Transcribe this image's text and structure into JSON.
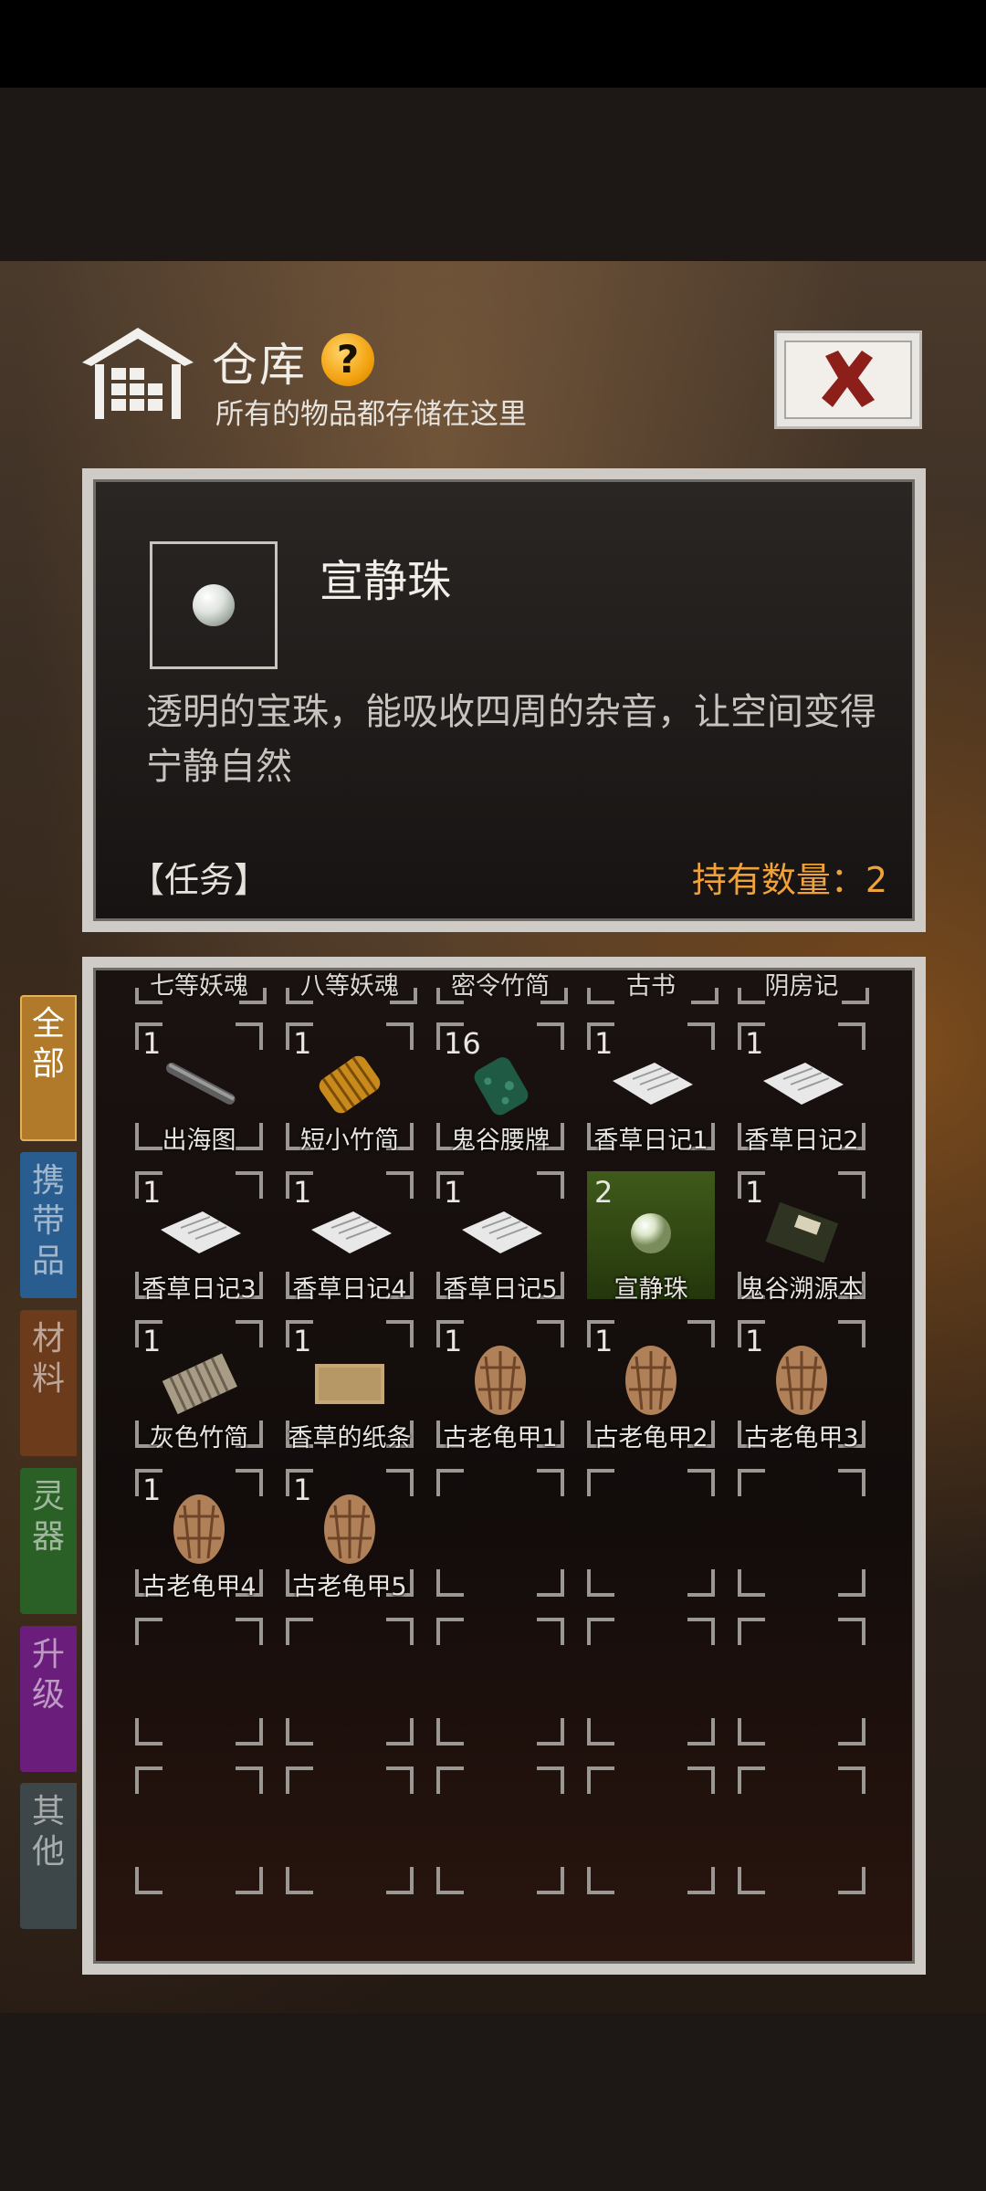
{
  "header": {
    "title": "仓库",
    "help": "?",
    "subtitle": "所有的物品都存储在这里",
    "close_icon": "close-x-icon"
  },
  "detail": {
    "name": "宣静珠",
    "description": "透明的宝珠，能吸收四周的杂音，让空间变得宁静自然",
    "tag": "【任务】",
    "count_text": "持有数量：2"
  },
  "tabs": [
    {
      "label": "全部",
      "color": "#b07a2a",
      "active": true
    },
    {
      "label": "携带品",
      "color": "#2a5d8f",
      "active": false
    },
    {
      "label": "材料",
      "color": "#6b3b1c",
      "active": false
    },
    {
      "label": "灵器",
      "color": "#2a5f25",
      "active": false
    },
    {
      "label": "升级",
      "color": "#6a1d7a",
      "active": false
    },
    {
      "label": "其他",
      "color": "#3d4648",
      "active": false
    }
  ],
  "grid": {
    "partial_row": [
      "七等妖魂",
      "八等妖魂",
      "密令竹简",
      "古书",
      "阴房记"
    ],
    "items": [
      {
        "qty": "1",
        "label": "出海图",
        "icon": "scroll-rod-icon"
      },
      {
        "qty": "1",
        "label": "短小竹简",
        "icon": "bamboo-slip-icon"
      },
      {
        "qty": "16",
        "label": "鬼谷腰牌",
        "icon": "jade-tablet-icon"
      },
      {
        "qty": "1",
        "label": "香草日记1",
        "icon": "paper-note-icon"
      },
      {
        "qty": "1",
        "label": "香草日记2",
        "icon": "paper-note-icon"
      },
      {
        "qty": "1",
        "label": "香草日记3",
        "icon": "paper-note-icon"
      },
      {
        "qty": "1",
        "label": "香草日记4",
        "icon": "paper-note-icon"
      },
      {
        "qty": "1",
        "label": "香草日记5",
        "icon": "paper-note-icon"
      },
      {
        "qty": "2",
        "label": "宣静珠",
        "icon": "pearl-icon",
        "selected": true
      },
      {
        "qty": "1",
        "label": "鬼谷溯源本",
        "icon": "book-icon"
      },
      {
        "qty": "1",
        "label": "灰色竹简",
        "icon": "bamboo-scroll-icon"
      },
      {
        "qty": "1",
        "label": "香草的纸条",
        "icon": "parchment-icon"
      },
      {
        "qty": "1",
        "label": "古老龟甲1",
        "icon": "turtle-shell-icon"
      },
      {
        "qty": "1",
        "label": "古老龟甲2",
        "icon": "turtle-shell-icon"
      },
      {
        "qty": "1",
        "label": "古老龟甲3",
        "icon": "turtle-shell-icon"
      },
      {
        "qty": "1",
        "label": "古老龟甲4",
        "icon": "turtle-shell-icon"
      },
      {
        "qty": "1",
        "label": "古老龟甲5",
        "icon": "turtle-shell-icon"
      }
    ]
  }
}
